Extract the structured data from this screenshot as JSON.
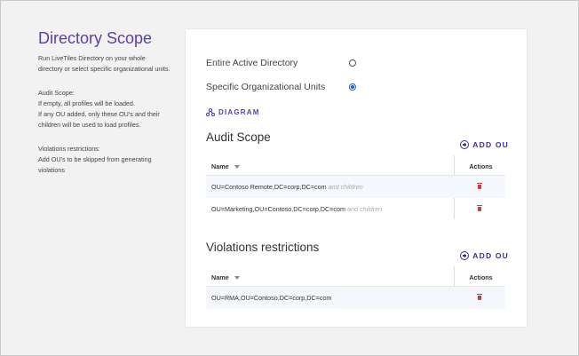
{
  "sidebar": {
    "title": "Directory Scope",
    "intro": "Run LiveTiles Directory on your whole directory or select specific organizational units.",
    "audit_help": "Audit Scope:\nIf empty, all profiles will be loaded.\nIf any OU added, only these OU's and their children will be used to load profiles.",
    "violations_help": "Violations restrictions:\nAdd OU's to be skipped from generating violations"
  },
  "scope_options": [
    {
      "label": "Entire Active Directory",
      "checked": false
    },
    {
      "label": "Specific Organizational Units",
      "checked": true
    }
  ],
  "diagram_label": "DIAGRAM",
  "audit_scope": {
    "title": "Audit Scope",
    "add_label": "ADD OU",
    "columns": {
      "name": "Name",
      "actions": "Actions"
    },
    "rows": [
      {
        "ou": "OU=Contoso Remote,DC=corp,DC=com",
        "suffix": "and children"
      },
      {
        "ou": "OU=Marketing,OU=Contoso,DC=corp,DC=com",
        "suffix": "and children"
      }
    ]
  },
  "violations": {
    "title": "Violations restrictions",
    "add_label": "ADD OU",
    "columns": {
      "name": "Name",
      "actions": "Actions"
    },
    "rows": [
      {
        "ou": "OU=RMA,OU=Contoso,DC=corp,DC=com",
        "suffix": ""
      }
    ]
  },
  "colors": {
    "accent": "#5b3fa8",
    "radio_checked": "#1e5dd6",
    "delete": "#d23b3b",
    "row_alt": "#f4f8fc"
  },
  "icons": {
    "diagram": "diagram-icon",
    "add": "plus-circle-icon",
    "delete": "trash-icon",
    "sort": "caret-down-icon"
  }
}
